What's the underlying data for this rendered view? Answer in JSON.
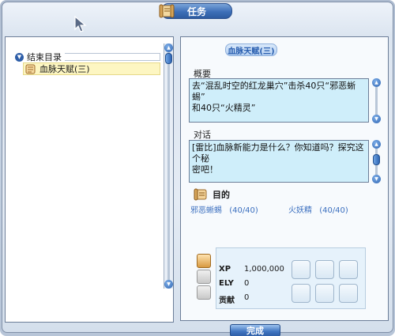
{
  "window": {
    "title": "任务"
  },
  "quest_list": {
    "category": "结束目录",
    "items": [
      {
        "label": "血脉天赋(三)",
        "selected": true
      }
    ]
  },
  "detail": {
    "quest_title": "血脉天赋(三)",
    "overview_label": "概要",
    "overview_lines": [
      "去“混乱时空的红龙巢穴”击杀40只“邪恶蜥蜴”",
      "和40只“火精灵”"
    ],
    "dialogue_label": "对话",
    "dialogue_lines": [
      "[雷比]血脉新能力是什么？你知道吗？探究这个秘",
      "密吧！"
    ],
    "goal_label": "目的",
    "targets": [
      {
        "name": "邪恶蜥蜴",
        "progress": "(40/40)"
      },
      {
        "name": "火妖精",
        "progress": "(40/40)"
      }
    ]
  },
  "rewards": {
    "rows": [
      {
        "key": "XP",
        "value": "1,000,000"
      },
      {
        "key": "ELY",
        "value": "0"
      },
      {
        "key": "贡献",
        "value": "0"
      }
    ],
    "slot_count": 6
  },
  "footer": {
    "complete_label": "完成"
  },
  "colors": {
    "accent": "#2d5ba0",
    "text_box": "#cfeefa",
    "selected": "#fdf6c2",
    "target_text": "#3b6fbf"
  }
}
